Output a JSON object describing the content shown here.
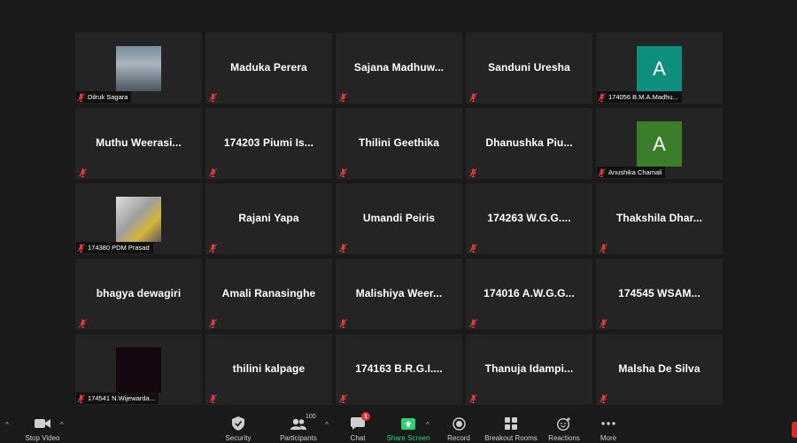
{
  "tiles": [
    {
      "type": "photo",
      "photo": "person",
      "caption": "Dilruk Sagara"
    },
    {
      "type": "name",
      "name": "Maduka Perera"
    },
    {
      "type": "name",
      "name": "Sajana  Madhuw..."
    },
    {
      "type": "name",
      "name": "Sanduni Uresha"
    },
    {
      "type": "avatar",
      "letter": "A",
      "color": "#0e8f7e",
      "caption": "174056 B.M.A.Madhu..."
    },
    {
      "type": "name",
      "name": "Muthu  Weerasi..."
    },
    {
      "type": "name",
      "name": "174203  Piumi  Is..."
    },
    {
      "type": "name",
      "name": "Thilini Geethika"
    },
    {
      "type": "name",
      "name": "Dhanushka  Piu..."
    },
    {
      "type": "avatar",
      "letter": "A",
      "color": "#3a7d2b",
      "caption": "Anushika Chamali"
    },
    {
      "type": "photo",
      "photo": "car",
      "caption": "174380 PDM Prasad"
    },
    {
      "type": "name",
      "name": "Rajani Yapa"
    },
    {
      "type": "name",
      "name": "Umandi Peiris"
    },
    {
      "type": "name",
      "name": "174263  W.G.G...."
    },
    {
      "type": "name",
      "name": "Thakshila  Dhar..."
    },
    {
      "type": "name",
      "name": "bhagya dewagiri"
    },
    {
      "type": "name",
      "name": "Amali Ranasinghe"
    },
    {
      "type": "name",
      "name": "Malishiya  Weer..."
    },
    {
      "type": "name",
      "name": "174016  A.W.G.G..."
    },
    {
      "type": "name",
      "name": "174545  WSAM..."
    },
    {
      "type": "photo",
      "photo": "dark",
      "caption": "174541 N.Wijewarda..."
    },
    {
      "type": "name",
      "name": "thilini kalpage"
    },
    {
      "type": "name",
      "name": "174163  B.R.G.I...."
    },
    {
      "type": "name",
      "name": "Thanuja  Idampi..."
    },
    {
      "type": "name",
      "name": "Malsha De Silva"
    }
  ],
  "toolbar": {
    "stop_video": "Stop Video",
    "security": "Security",
    "participants": "Participants",
    "participants_count": "100",
    "chat": "Chat",
    "chat_badge": "1",
    "share_screen": "Share Screen",
    "record": "Record",
    "breakout_rooms": "Breakout Rooms",
    "reactions": "Reactions",
    "more": "More"
  },
  "colors": {
    "mute_red": "#e03a3a",
    "share_green": "#2fd06e",
    "tile_bg": "#242424"
  },
  "icons": {
    "mute": "muted-mic-icon",
    "video": "video-camera-icon",
    "security": "shield-icon",
    "participants": "people-icon",
    "chat": "chat-bubble-icon",
    "share": "share-arrow-icon",
    "record": "record-icon",
    "breakout": "grid-squares-icon",
    "reactions": "smiley-plus-icon",
    "more": "ellipsis-icon"
  }
}
